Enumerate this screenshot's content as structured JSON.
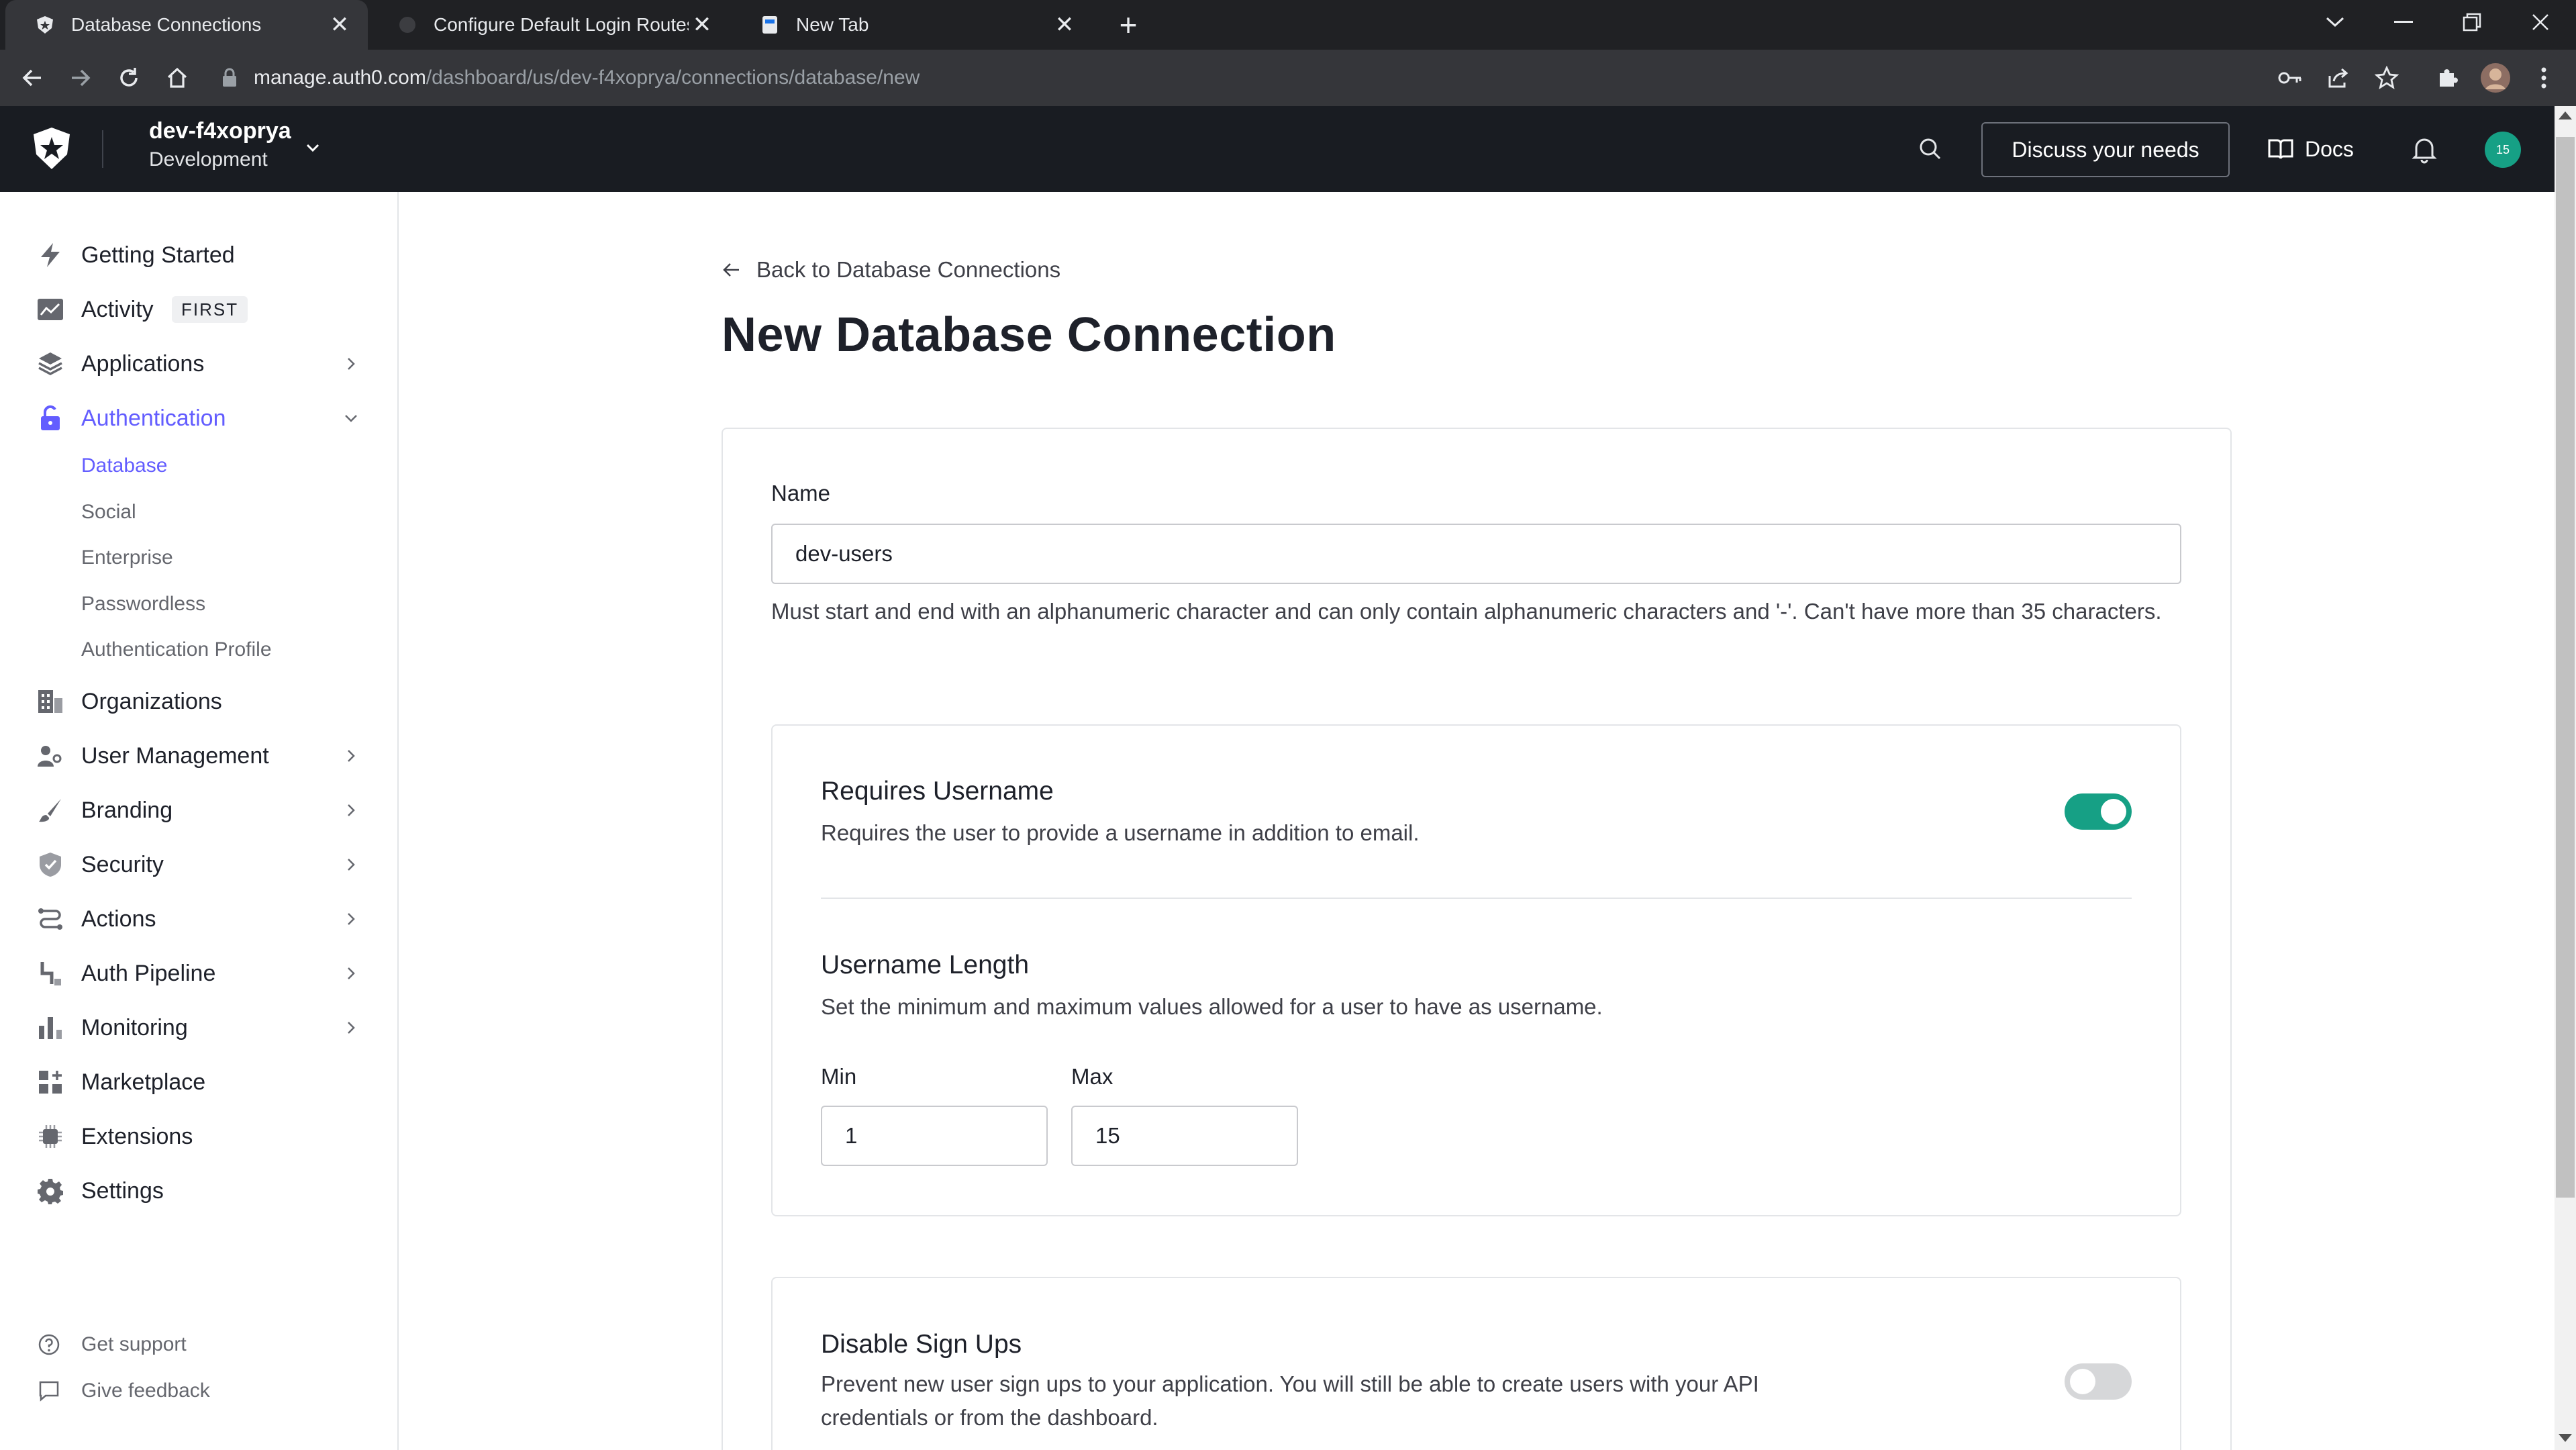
{
  "browser": {
    "tabs": [
      {
        "title": "Database Connections",
        "active": true,
        "icon": "auth0-shield-icon"
      },
      {
        "title": "Configure Default Login Routes",
        "active": false,
        "icon": "globe-icon"
      },
      {
        "title": "New Tab",
        "active": false,
        "icon": "document-icon"
      }
    ],
    "url_host": "manage.auth0.com",
    "url_path": "/dashboard/us/dev-f4xoprya/connections/database/new"
  },
  "header": {
    "tenant_name": "dev-f4xoprya",
    "tenant_env": "Development",
    "discuss_label": "Discuss your needs",
    "docs_label": "Docs",
    "avatar_text": "15",
    "accent_color": "#16a085"
  },
  "sidebar": {
    "items": [
      {
        "label": "Getting Started",
        "icon": "bolt-icon"
      },
      {
        "label": "Activity",
        "icon": "activity-chart-icon",
        "badge": "FIRST"
      },
      {
        "label": "Applications",
        "icon": "layers-icon"
      },
      {
        "label": "Authentication",
        "icon": "unlock-icon",
        "active": true
      },
      {
        "label": "Organizations",
        "icon": "building-icon"
      },
      {
        "label": "User Management",
        "icon": "users-icon"
      },
      {
        "label": "Branding",
        "icon": "brush-icon"
      },
      {
        "label": "Security",
        "icon": "shield-icon"
      },
      {
        "label": "Actions",
        "icon": "actions-flow-icon"
      },
      {
        "label": "Auth Pipeline",
        "icon": "pipeline-icon"
      },
      {
        "label": "Monitoring",
        "icon": "bar-chart-icon"
      },
      {
        "label": "Marketplace",
        "icon": "grid-plus-icon"
      },
      {
        "label": "Extensions",
        "icon": "chip-icon"
      },
      {
        "label": "Settings",
        "icon": "gear-icon"
      }
    ],
    "sub_items": [
      "Database",
      "Social",
      "Enterprise",
      "Passwordless",
      "Authentication Profile"
    ],
    "footer": [
      {
        "label": "Get support",
        "icon": "help-circle-icon"
      },
      {
        "label": "Give feedback",
        "icon": "chat-bubble-icon"
      }
    ],
    "active_color": "#635dff"
  },
  "main": {
    "back_label": "Back to Database Connections",
    "title": "New Database Connection",
    "name_label": "Name",
    "name_value": "dev-users",
    "name_help": "Must start and end with an alphanumeric character and can only contain alphanumeric characters and '-'. Can't have more than 35 characters.",
    "requires_username": {
      "title": "Requires Username",
      "description": "Requires the user to provide a username in addition to email.",
      "enabled": true
    },
    "username_length": {
      "title": "Username Length",
      "description": "Set the minimum and maximum values allowed for a user to have as username.",
      "min_label": "Min",
      "min_value": "1",
      "max_label": "Max",
      "max_value": "15"
    },
    "disable_signups": {
      "title": "Disable Sign Ups",
      "description": "Prevent new user sign ups to your application. You will still be able to create users with your API credentials or from the dashboard.",
      "enabled": false
    }
  }
}
